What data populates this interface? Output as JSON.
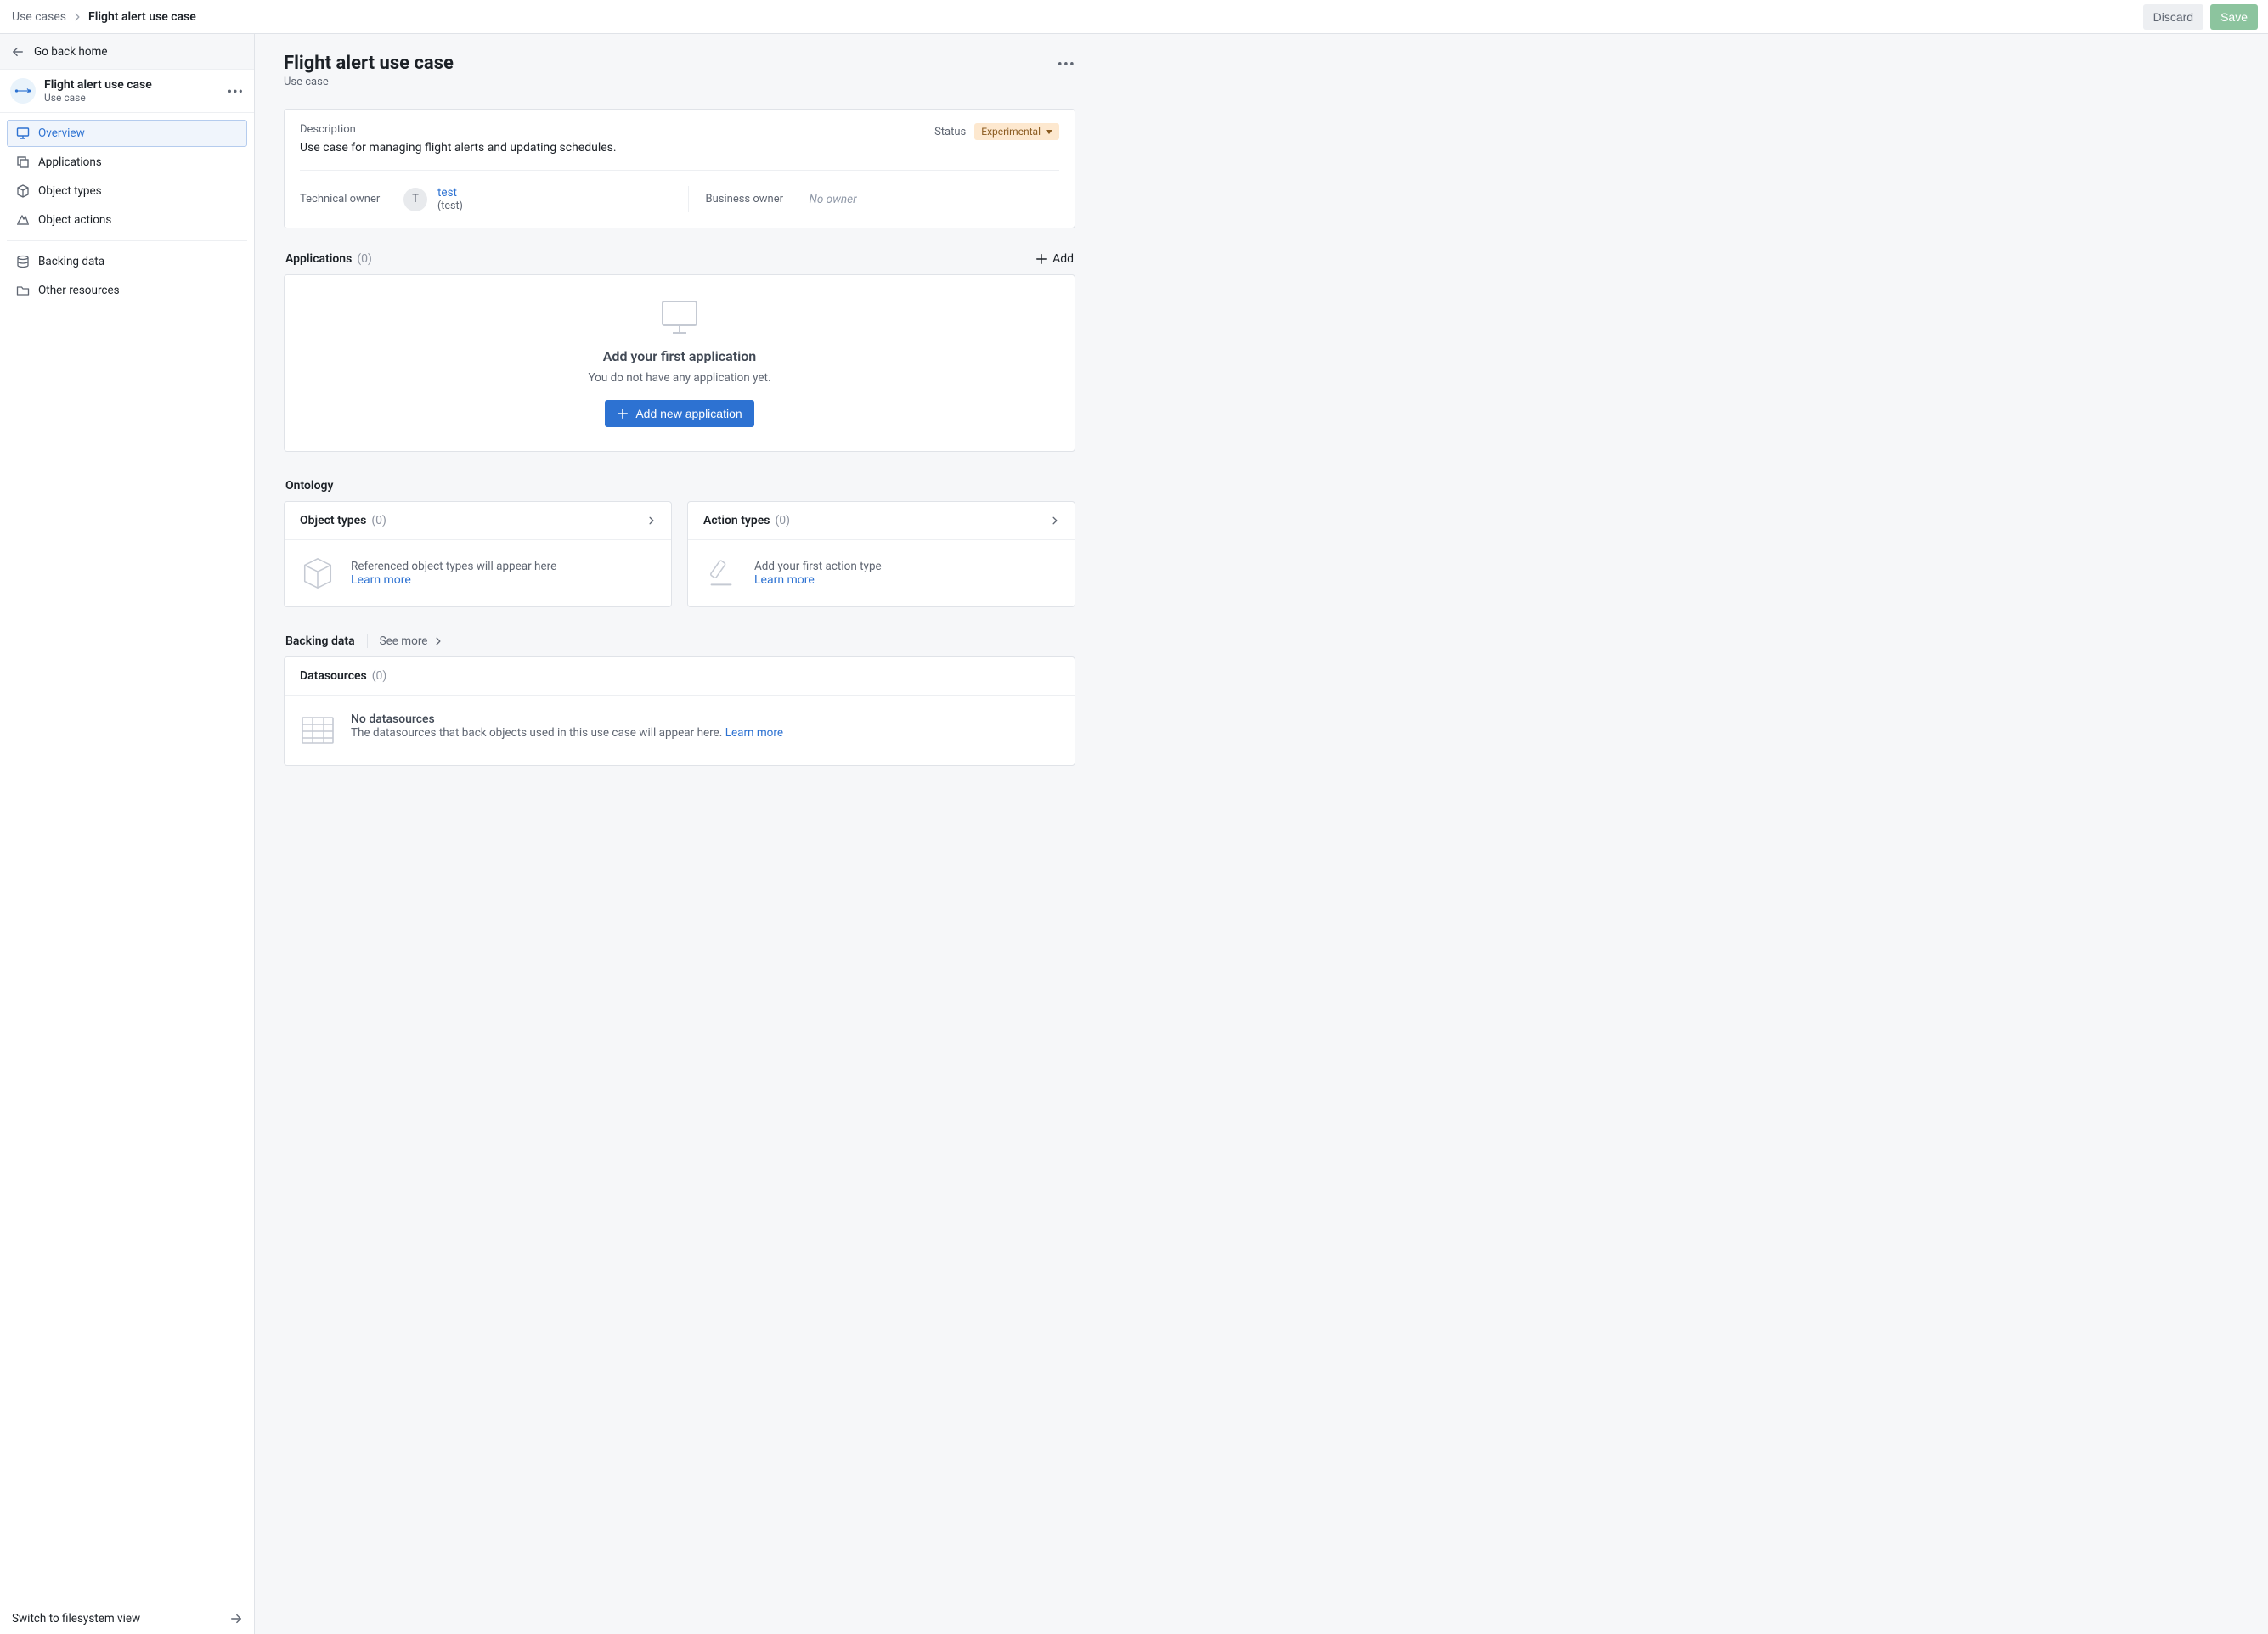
{
  "breadcrumb": {
    "root": "Use cases",
    "current": "Flight alert use case"
  },
  "topbar": {
    "discard": "Discard",
    "save": "Save"
  },
  "sidebar": {
    "go_back": "Go back home",
    "title": "Flight alert use case",
    "subtitle": "Use case",
    "nav": {
      "overview": "Overview",
      "applications": "Applications",
      "object_types": "Object types",
      "object_actions": "Object actions",
      "backing_data": "Backing data",
      "other": "Other resources"
    },
    "footer": "Switch to filesystem view"
  },
  "page": {
    "title": "Flight alert use case",
    "subtitle": "Use case"
  },
  "description": {
    "label": "Description",
    "text": "Use case for managing flight alerts and updating schedules.",
    "status_label": "Status",
    "status_value": "Experimental",
    "tech_owner_label": "Technical owner",
    "tech_owner_name": "test",
    "tech_owner_sub": "(test)",
    "tech_owner_initial": "T",
    "biz_owner_label": "Business owner",
    "biz_owner_none": "No owner"
  },
  "applications": {
    "title": "Applications",
    "count": "(0)",
    "add": "Add",
    "empty_title": "Add your first application",
    "empty_sub": "You do not have any application yet.",
    "cta": "Add new application"
  },
  "ontology": {
    "title": "Ontology",
    "object_types": {
      "title": "Object types",
      "count": "(0)",
      "msg": "Referenced object types will appear here",
      "learn": "Learn more"
    },
    "action_types": {
      "title": "Action types",
      "count": "(0)",
      "msg": "Add your first action type",
      "learn": "Learn more"
    }
  },
  "backing_data": {
    "title": "Backing data",
    "see_more": "See more",
    "datasources": {
      "title": "Datasources",
      "count": "(0)",
      "empty_title": "No datasources",
      "empty_sub_prefix": "The datasources that back objects used in this use case will appear here. ",
      "learn": "Learn more"
    }
  }
}
